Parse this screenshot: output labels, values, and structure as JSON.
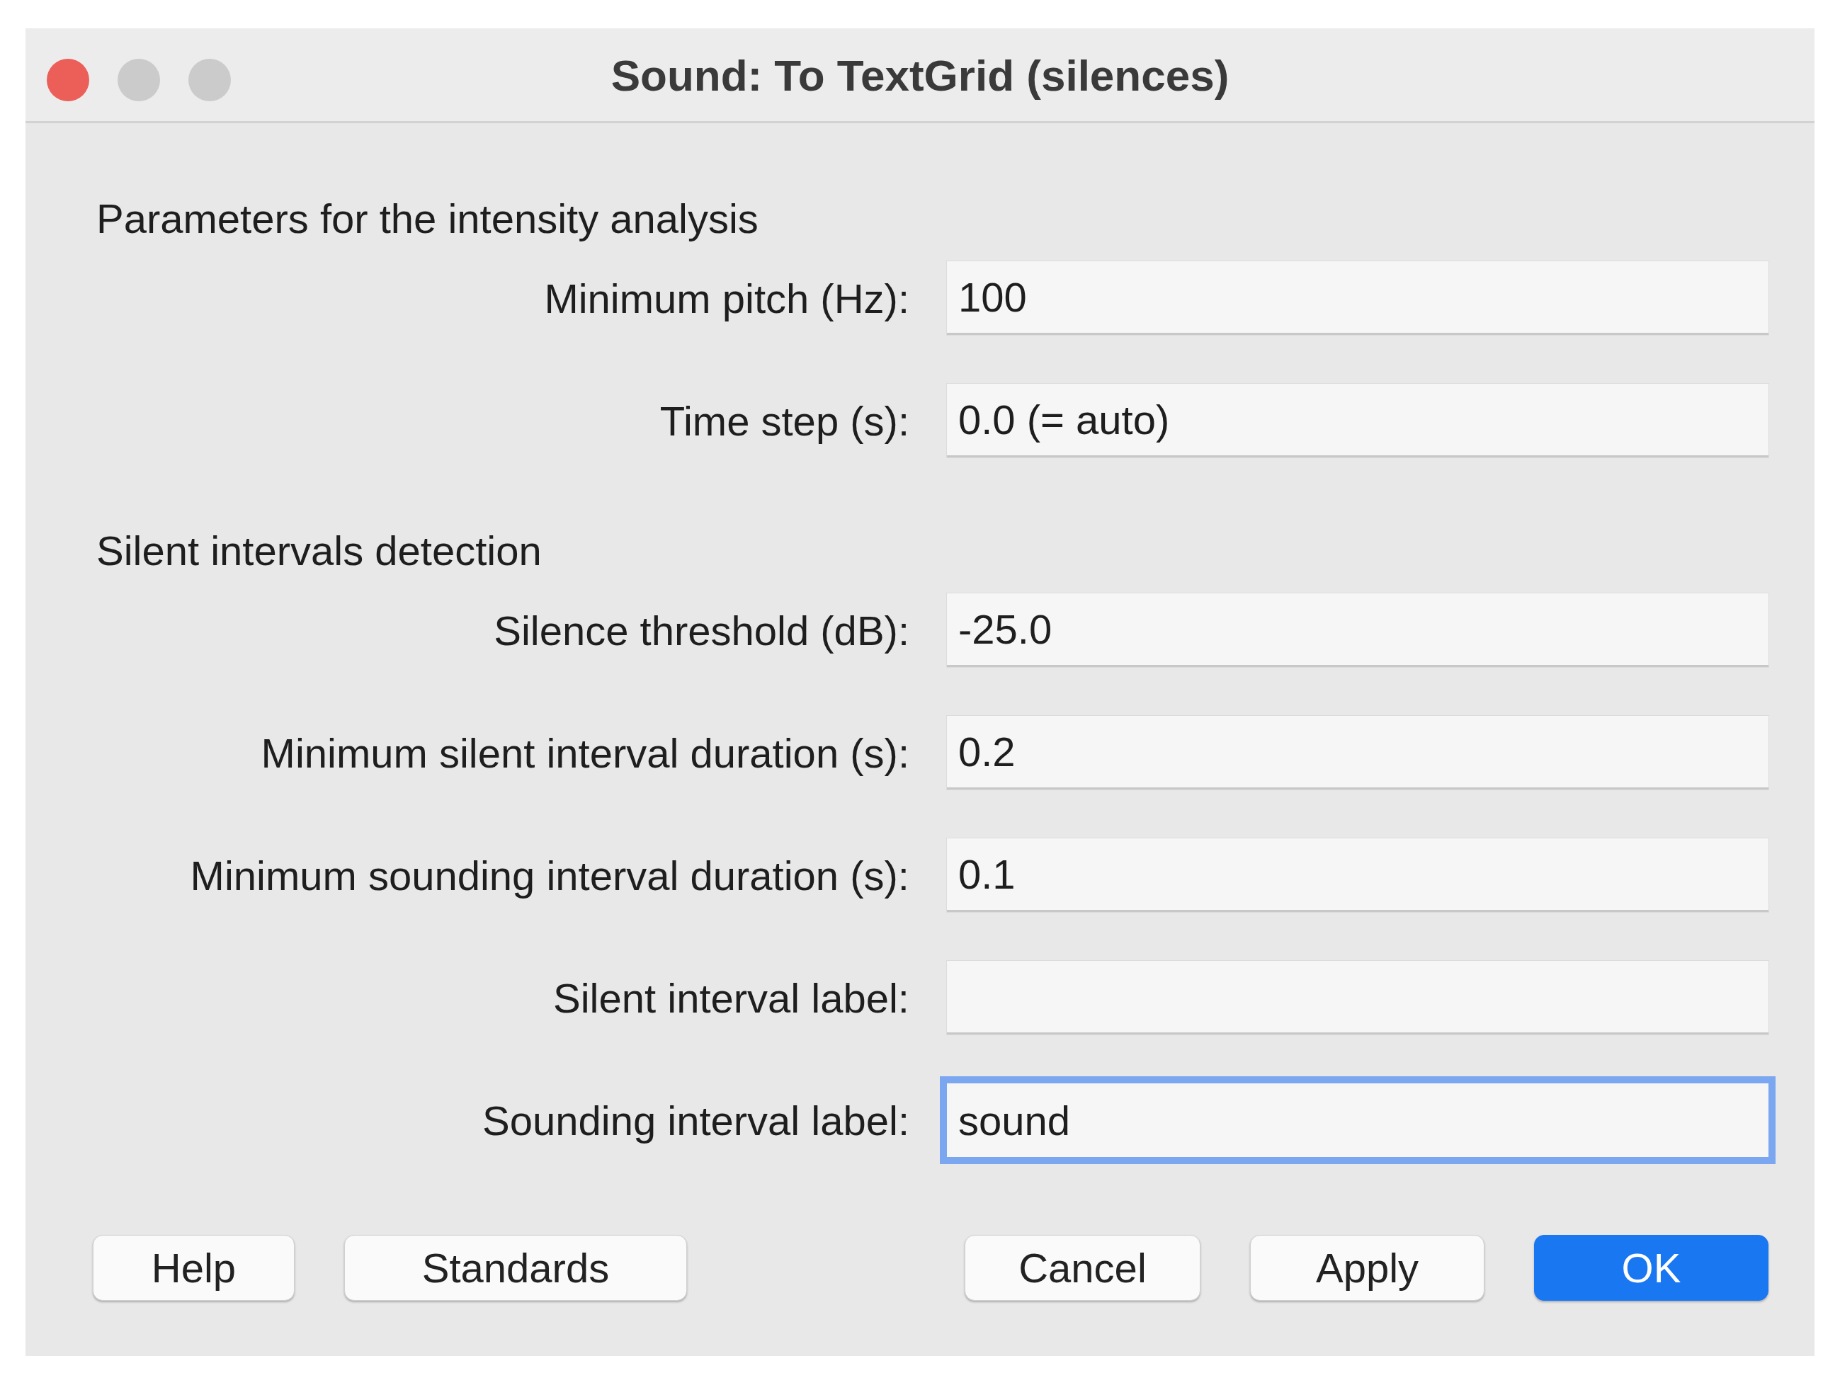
{
  "window": {
    "title": "Sound: To TextGrid (silences)",
    "controls": [
      {
        "color": "#ec5f58"
      },
      {
        "color": "#cbcbcb"
      },
      {
        "color": "#cbcbcb"
      }
    ]
  },
  "sections": [
    {
      "heading": "Parameters for the intensity analysis",
      "fields": [
        {
          "label": "Minimum pitch (Hz):",
          "value": "100",
          "focused": false
        },
        {
          "label": "Time step (s):",
          "value": "0.0 (= auto)",
          "focused": false
        }
      ]
    },
    {
      "heading": "Silent intervals detection",
      "fields": [
        {
          "label": "Silence threshold (dB):",
          "value": "-25.0",
          "focused": false
        },
        {
          "label": "Minimum silent interval duration (s):",
          "value": "0.2",
          "focused": false
        },
        {
          "label": "Minimum sounding interval duration (s):",
          "value": "0.1",
          "focused": false
        },
        {
          "label": "Silent interval label:",
          "focused": false
        },
        {
          "label": "Sounding interval label:",
          "value": "sound",
          "focused": true
        }
      ]
    }
  ],
  "left_buttons": [
    {
      "label": "Help",
      "default": false
    },
    {
      "label": "Standards",
      "default": false
    }
  ],
  "right_buttons": [
    {
      "label": "Cancel",
      "default": false
    },
    {
      "label": "Apply",
      "default": false
    },
    {
      "label": "OK",
      "default": true
    }
  ]
}
